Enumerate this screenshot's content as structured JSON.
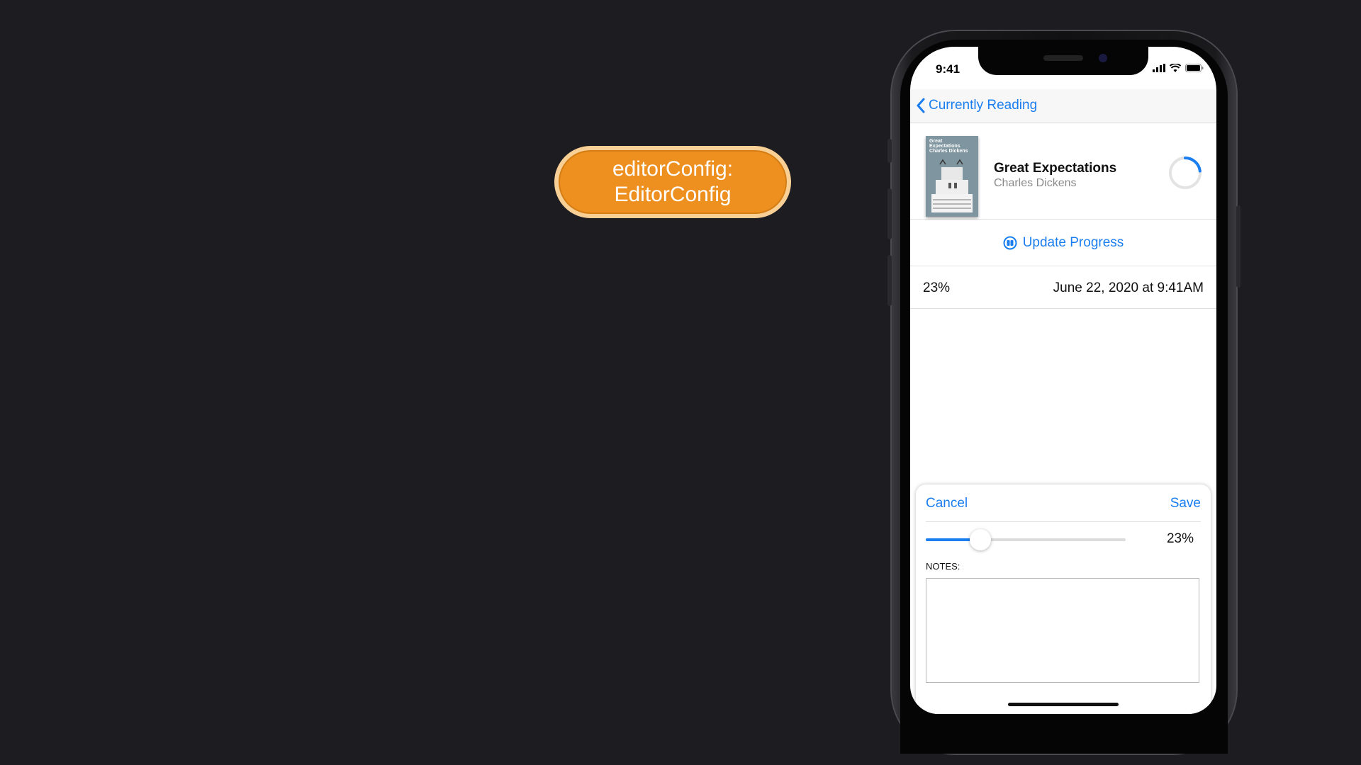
{
  "annotation": {
    "line1": "editorConfig:",
    "line2": "EditorConfig",
    "color": "#ee901f"
  },
  "status_bar": {
    "time": "9:41",
    "icons": [
      "cellular-signal-icon",
      "wifi-icon",
      "battery-icon"
    ]
  },
  "nav": {
    "back_label": "Currently Reading",
    "back_icon": "chevron-left-icon",
    "accent": "#1a7ef0"
  },
  "book": {
    "cover_text": "Great Expectations Charles Dickens",
    "title": "Great Expectations",
    "author": "Charles Dickens",
    "progress_fraction": 0.23
  },
  "actions": {
    "update_progress_label": "Update Progress",
    "update_progress_icon": "book-icon"
  },
  "progress_entries": [
    {
      "percent": "23%",
      "date": "June 22, 2020 at 9:41AM"
    }
  ],
  "editor": {
    "cancel_label": "Cancel",
    "save_label": "Save",
    "slider_value_label": "23%",
    "slider_fraction": 0.23,
    "notes_label": "NOTES:",
    "notes_value": ""
  }
}
